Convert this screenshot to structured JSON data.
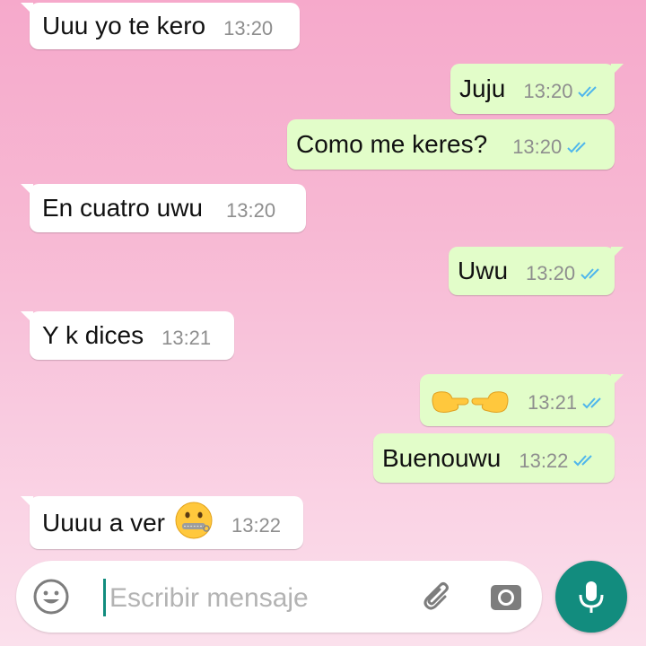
{
  "messages": [
    {
      "direction": "in",
      "text": "Uuu yo te kero",
      "time": "13:20"
    },
    {
      "direction": "out",
      "text": "Juju",
      "time": "13:20",
      "status": "read"
    },
    {
      "direction": "out",
      "text": "Como me keres?",
      "time": "13:20",
      "status": "read"
    },
    {
      "direction": "in",
      "text": "En cuatro uwu",
      "time": "13:20"
    },
    {
      "direction": "out",
      "text": "Uwu",
      "time": "13:20",
      "status": "read"
    },
    {
      "direction": "in",
      "text": "Y k dices",
      "time": "13:21"
    },
    {
      "direction": "out",
      "text": "",
      "emoji": "pointing-fingers",
      "time": "13:21",
      "status": "read"
    },
    {
      "direction": "out",
      "text": "Buenouwu",
      "time": "13:22",
      "status": "read"
    },
    {
      "direction": "in",
      "text": "Uuuu a ver",
      "emoji": "zipper-mouth-face",
      "time": "13:22"
    }
  ],
  "composer": {
    "placeholder": "Escribir mensaje",
    "value": "",
    "icons": [
      "emoji-icon",
      "paperclip-icon",
      "camera-icon",
      "microphone-icon"
    ]
  },
  "colors": {
    "incoming_bubble": "#ffffff",
    "outgoing_bubble": "#e2fdc9",
    "read_ticks": "#4fb6ec",
    "accent": "#128c7e"
  }
}
